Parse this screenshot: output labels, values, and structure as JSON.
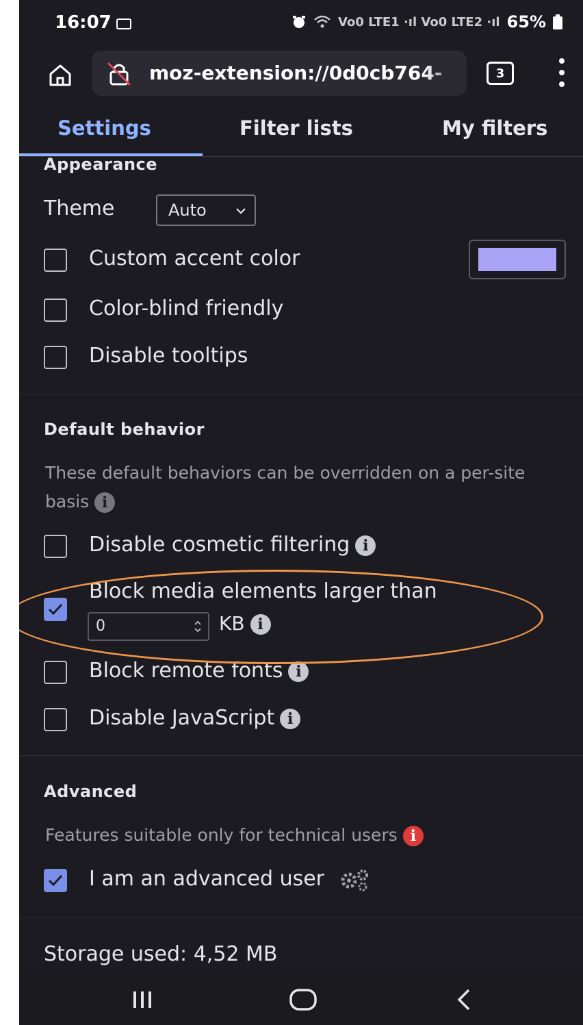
{
  "status_bar": {
    "time": "16:07",
    "network_labels": "Vo0 LTE1 ·ıl Vo0 LTE2 ·ıl",
    "battery": "65%"
  },
  "browser": {
    "url": "moz-extension://0d0cb764-",
    "tabs_count": "3"
  },
  "tabs": [
    {
      "label": "Settings",
      "active": true
    },
    {
      "label": "Filter lists",
      "active": false
    },
    {
      "label": "My filters",
      "active": false
    }
  ],
  "appearance": {
    "title": "Appearance",
    "theme_label": "Theme",
    "theme_value": "Auto",
    "custom_accent_label": "Custom accent color",
    "accent_color": "#a9a4f5",
    "color_blind_label": "Color-blind friendly",
    "disable_tooltips_label": "Disable tooltips"
  },
  "default_behavior": {
    "title": "Default behavior",
    "description": "These default behaviors can be overridden on a per-site basis",
    "disable_cosmetic_label": "Disable cosmetic filtering",
    "block_media_label": "Block media elements larger than",
    "block_media_value": "0",
    "block_media_unit": "KB",
    "block_fonts_label": "Block remote fonts",
    "disable_js_label": "Disable JavaScript"
  },
  "advanced": {
    "title": "Advanced",
    "description": "Features suitable only for technical users",
    "advanced_user_label": "I am an advanced user"
  },
  "storage": {
    "label": "Storage used: 4,52 MB"
  },
  "colors": {
    "background": "#1c1b22",
    "accent": "#8fb3ff",
    "checkbox_checked": "#7a8fe8",
    "annotation": "#f0964a"
  }
}
